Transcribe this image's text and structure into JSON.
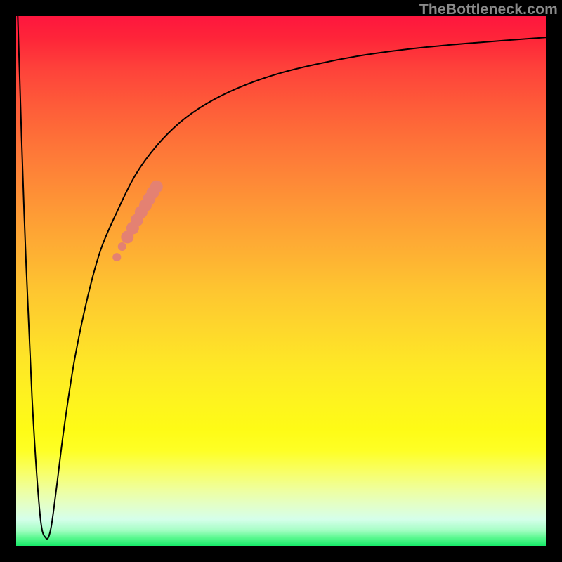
{
  "watermark": "TheBottleneck.com",
  "chart_data": {
    "type": "line",
    "title": "",
    "xlabel": "",
    "ylabel": "",
    "xlim": [
      0,
      100
    ],
    "ylim": [
      0,
      100
    ],
    "grid": false,
    "legend": false,
    "series": [
      {
        "name": "bottleneck-curve",
        "color": "#000000",
        "x": [
          0.3,
          1.5,
          3.0,
          4.5,
          5.6,
          6.5,
          7.5,
          9.0,
          11.0,
          13.5,
          16.0,
          19.0,
          22.5,
          26.5,
          31.0,
          36.0,
          42.0,
          49.0,
          57.0,
          66.0,
          76.0,
          87.0,
          100.0
        ],
        "y": [
          100,
          63,
          28,
          6,
          1.5,
          3,
          10,
          22,
          35,
          47,
          56,
          63,
          70,
          75.5,
          80,
          83.5,
          86.5,
          89,
          91,
          92.7,
          94,
          95,
          96
        ]
      }
    ],
    "highlight": {
      "name": "highlight-segment",
      "color": "#e48172",
      "x": [
        19.0,
        20.0,
        21.0,
        22.0,
        22.8,
        23.6,
        24.4,
        25.1,
        25.8,
        26.5
      ],
      "y": [
        54.5,
        56.5,
        58.3,
        60.0,
        61.5,
        63.0,
        64.3,
        65.5,
        66.7,
        67.8
      ]
    }
  }
}
